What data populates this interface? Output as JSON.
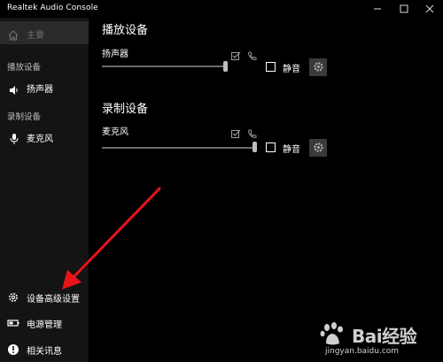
{
  "window": {
    "title": "Realtek Audio Console"
  },
  "sidebar": {
    "home_label": "主要",
    "playback_section": "播放设备",
    "playback_item": "扬声器",
    "record_section": "录制设备",
    "record_item": "麦克风",
    "bottom_items": [
      {
        "label": "设备高级设置",
        "icon": "gear-icon"
      },
      {
        "label": "电源管理",
        "icon": "battery-icon"
      },
      {
        "label": "相关讯息",
        "icon": "info-icon"
      }
    ]
  },
  "main": {
    "playback_header": "播放设备",
    "speaker": {
      "name": "扬声器",
      "volume_fraction": 0.98,
      "mute_label": "静音",
      "muted": false
    },
    "record_header": "录制设备",
    "mic": {
      "name": "麦克风",
      "volume_fraction": 1.0,
      "mute_label": "静音",
      "muted": false
    }
  },
  "annotation": {
    "arrow_color": "#e8141a"
  },
  "watermark": {
    "brand": "Bai经验",
    "url": "jingyan.baidu.com"
  }
}
